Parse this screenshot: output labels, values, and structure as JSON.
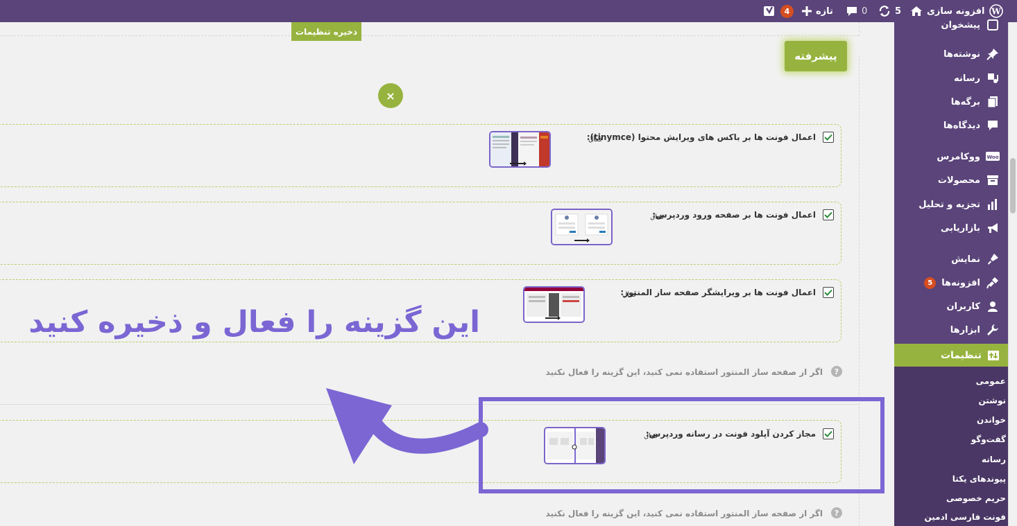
{
  "adminbar": {
    "site_name": "افزونه سازی",
    "updates_count": "5",
    "comments_count": "0",
    "new_label": "تازه",
    "yoast_badge": "4"
  },
  "sidebar": {
    "items": [
      {
        "label": "پیشخوان",
        "icon": "dashboard-icon"
      },
      {
        "label": "نوشته‌ها",
        "icon": "pin-icon"
      },
      {
        "label": "رسانه",
        "icon": "media-icon"
      },
      {
        "label": "برگه‌ها",
        "icon": "page-icon"
      },
      {
        "label": "دیدگاه‌ها",
        "icon": "comment-icon"
      },
      {
        "label": "ووکامرس",
        "icon": "woo-icon"
      },
      {
        "label": "محصولات",
        "icon": "archive-icon"
      },
      {
        "label": "تجزیه و تحلیل",
        "icon": "chart-icon"
      },
      {
        "label": "بازاریابی",
        "icon": "megaphone-icon"
      },
      {
        "label": "نمایش",
        "icon": "brush-icon"
      },
      {
        "label": "افزونه‌ها",
        "icon": "plugin-icon",
        "badge": "5"
      },
      {
        "label": "کاربران",
        "icon": "user-icon"
      },
      {
        "label": "ابزارها",
        "icon": "wrench-icon"
      }
    ],
    "active": {
      "label": "تنظیمات",
      "icon": "settings-icon"
    },
    "submenu": [
      "عمومی",
      "نوشتن",
      "خواندن",
      "گفت‌وگو",
      "رسانه",
      "پیوندهای یکتا",
      "حریم خصوصی",
      "فونت فارسی ادمین"
    ]
  },
  "content": {
    "save_button": "ذخیره تنظیمات",
    "section_title": "پیشرفته",
    "close_symbol": "×",
    "active_label": "فعال",
    "options": [
      {
        "label": "اعمال فونت ها بر باکس های ویرایش محتوا (tinymce):",
        "checked": true
      },
      {
        "label": "اعمال فونت ها بر صفحه ورود وردپرس:",
        "checked": true
      },
      {
        "label": "اعمال فونت ها بر ویرایشگر صفحه ساز المنتور:",
        "checked": true
      },
      {
        "label": "مجاز کردن آپلود فونت در رسانه وردپرس:",
        "checked": true
      }
    ],
    "help_text": "اگر از صفحه ساز المنتور استفاده نمی کنید، این گزینه را فعال نکنید",
    "help_icon": "?"
  },
  "annotation": {
    "note": "این گزینه را فعال و ذخیره کنید",
    "accent": "#7b66d4"
  },
  "colors": {
    "admin_purple": "#5a4479",
    "accent_green": "#97b33f"
  }
}
